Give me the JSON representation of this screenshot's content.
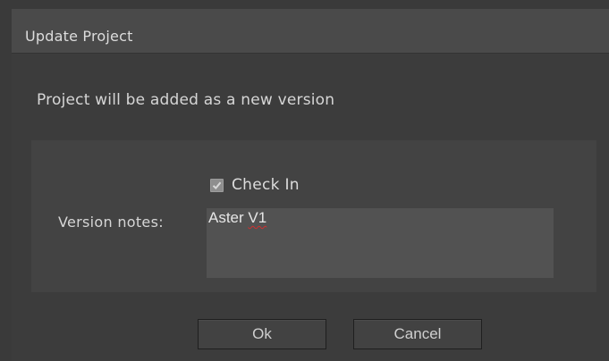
{
  "dialog": {
    "title": "Update Project",
    "message": "Project will be added as a new version",
    "checkin": {
      "label": "Check In",
      "checked": true
    },
    "notes": {
      "label": "Version notes:",
      "value_prefix": "Aster ",
      "value_misspelled": "V1"
    },
    "buttons": {
      "ok": "Ok",
      "cancel": "Cancel"
    }
  }
}
